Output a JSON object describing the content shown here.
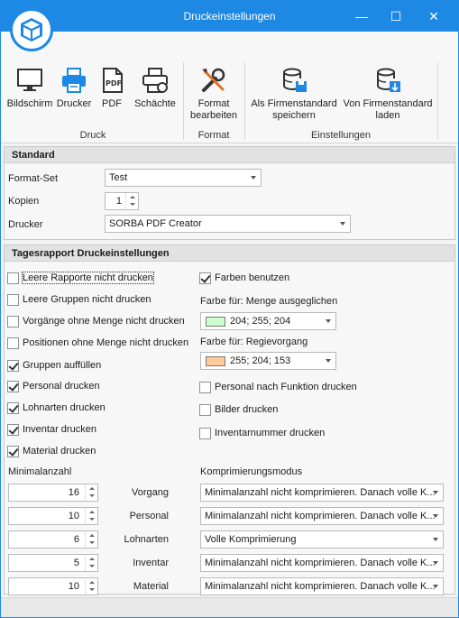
{
  "window": {
    "title": "Druckeinstellungen",
    "minimize": "—",
    "maximize": "☐",
    "close": "✕"
  },
  "ribbon": {
    "buttons": {
      "bildschirm": "Bildschirm",
      "drucker": "Drucker",
      "pdf": "PDF",
      "schaechte": "Schächte",
      "format_line1": "Format",
      "format_line2": "bearbeiten",
      "als_firmenstandard_line1": "Als Firmenstandard",
      "als_firmenstandard_line2": "speichern",
      "von_firmenstandard_line1": "Von Firmenstandard",
      "von_firmenstandard_line2": "laden"
    },
    "groups": {
      "druck": "Druck",
      "format": "Format",
      "einstellungen": "Einstellungen"
    }
  },
  "standard": {
    "title": "Standard",
    "format_set_label": "Format-Set",
    "format_set_value": "Test",
    "kopien_label": "Kopien",
    "kopien_value": "1",
    "drucker_label": "Drucker",
    "drucker_value": "SORBA PDF Creator"
  },
  "tagesrapport": {
    "title": "Tagesrapport Druckeinstellungen",
    "left_checkboxes": [
      {
        "label": "Leere Rapporte nicht drucken",
        "checked": false
      },
      {
        "label": "Leere Gruppen nicht drucken",
        "checked": false
      },
      {
        "label": "Vorgänge ohne Menge nicht drucken",
        "checked": false
      },
      {
        "label": "Positionen ohne Menge nicht drucken",
        "checked": false
      },
      {
        "label": "Gruppen auffüllen",
        "checked": true
      },
      {
        "label": "Personal drucken",
        "checked": true
      },
      {
        "label": "Lohnarten drucken",
        "checked": true
      },
      {
        "label": "Inventar drucken",
        "checked": true
      },
      {
        "label": "Material drucken",
        "checked": true
      }
    ],
    "farben_benutzen": {
      "label": "Farben benutzen",
      "checked": true
    },
    "farbe_menge_label": "Farbe für: Menge ausgeglichen",
    "farbe_menge_value": "204; 255; 204",
    "farbe_menge_color": "#ccffcc",
    "farbe_regie_label": "Farbe für: Regievorgang",
    "farbe_regie_value": "255; 204; 153",
    "farbe_regie_color": "#ffcc99",
    "right_checkboxes": [
      {
        "label": "Personal nach Funktion drucken",
        "checked": false
      },
      {
        "label": "Bilder drucken",
        "checked": false
      },
      {
        "label": "Inventarnummer drucken",
        "checked": false
      }
    ],
    "minimalanzahl_label": "Minimalanzahl",
    "komprimierungsmodus_label": "Komprimierungsmodus",
    "rows": [
      {
        "value": "16",
        "name": "Vorgang",
        "mode": "Minimalanzahl nicht komprimieren. Danach volle K..."
      },
      {
        "value": "10",
        "name": "Personal",
        "mode": "Minimalanzahl nicht komprimieren. Danach volle K..."
      },
      {
        "value": "6",
        "name": "Lohnarten",
        "mode": "Volle Komprimierung"
      },
      {
        "value": "5",
        "name": "Inventar",
        "mode": "Minimalanzahl nicht komprimieren. Danach volle K..."
      },
      {
        "value": "10",
        "name": "Material",
        "mode": "Minimalanzahl nicht komprimieren. Danach volle K..."
      }
    ]
  }
}
